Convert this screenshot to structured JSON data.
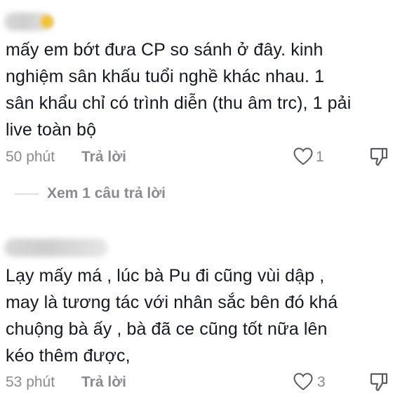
{
  "comments": [
    {
      "text": "mấy em bớt đưa CP so sánh ở đây. kinh nghiệm sân khấu tuổi nghề khác nhau. 1 sân khẩu chỉ có trình diễn (thu âm trc), 1 pải live toàn bộ",
      "lines": [
        "mấy em bớt đưa CP so sánh ở đây. kinh",
        "nghiệm sân khấu tuổi nghề khác nhau. 1",
        "sân khẩu chỉ có trình diễn (thu âm trc), 1 pải",
        "live toàn bộ"
      ],
      "time": "50 phút",
      "reply_label": "Trả lời",
      "likes": "1"
    },
    {
      "text": "Lạy mấy má , lúc bà Pu đi cũng vùi dập , may là tương tác với nhân sắc bên đó khá chuộng bà ấy , bà đã ce cũng tốt nữa lên kéo thêm được,",
      "lines": [
        "Lạy mấy má , lúc bà Pu đi cũng vùi dập ,",
        "may là tương tác với nhân sắc bên đó khá",
        "chuộng bà ấy , bà đã ce cũng tốt nữa lên",
        "kéo thêm được,"
      ],
      "time": "53 phút",
      "reply_label": "Trả lời",
      "likes": "3"
    }
  ],
  "view_replies_label": "Xem 1 câu trả lời",
  "colors": {
    "text": "#161823",
    "muted": "#8a8b91"
  },
  "icons": [
    "heart-outline-icon",
    "dislike-icon"
  ]
}
